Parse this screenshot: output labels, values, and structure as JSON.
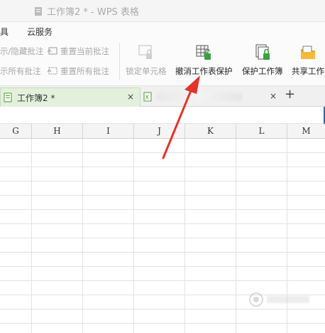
{
  "window": {
    "title": "工作簿2 * - WPS 表格"
  },
  "menu": {
    "item1": "具",
    "item2": "云服务"
  },
  "ribbon": {
    "show_hide_comments": "示/隐藏批注",
    "reset_current_comment": "重置当前批注",
    "show_all_comments": "示所有批注",
    "reset_all_comments": "重置所有批注",
    "lock_cell": "锁定单元格",
    "unprotect_sheet": "撤消工作表保护",
    "protect_workbook": "保护工作簿",
    "share_workbook": "共享工作"
  },
  "tabs": {
    "active": "工作簿2 *",
    "close": "×",
    "new": "+"
  },
  "columns": [
    "G",
    "H",
    "I",
    "J",
    "K",
    "L",
    "M"
  ],
  "colors": {
    "accent": "#2a6ab8",
    "arrow": "#e5332a",
    "tab_active_bg": "#e3f0dc"
  }
}
